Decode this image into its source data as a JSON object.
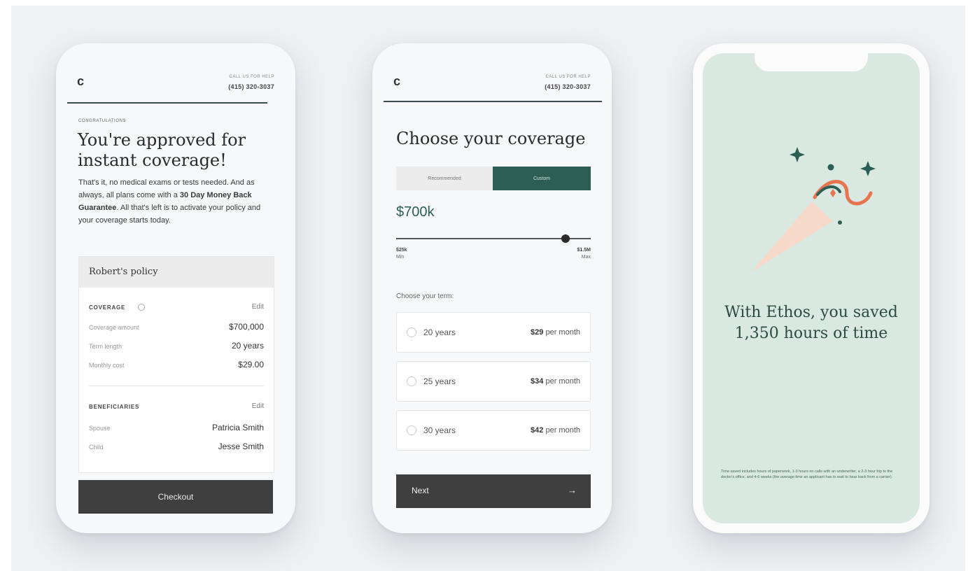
{
  "phone1": {
    "logo": "c",
    "call_label": "CALL US FOR HELP",
    "phone_number": "(415) 320-3037",
    "eyebrow": "CONGRATULATIONS",
    "headline": "You're approved for instant coverage!",
    "body_before": "That's it, no medical exams or tests needed. And as always, all plans come with a ",
    "body_bold": "30 Day Money Back Guarantee",
    "body_after": ". All that's left is to activate your policy and your coverage starts today.",
    "policy": {
      "title": "Robert's policy",
      "coverage_section": "COVERAGE",
      "info_icon": "info-icon",
      "coverage_edit": "Edit",
      "rows": [
        {
          "label": "Coverage amount",
          "value": "$700,000"
        },
        {
          "label": "Term length",
          "value": "20 years"
        },
        {
          "label": "Monthly cost",
          "value": "$29.00"
        }
      ],
      "beneficiaries_section": "BENEFICIARIES",
      "beneficiaries_edit": "Edit",
      "beneficiaries": [
        {
          "label": "Spouse",
          "value": "Patricia Smith"
        },
        {
          "label": "Child",
          "value": "Jesse Smith"
        }
      ]
    },
    "checkout_label": "Checkout"
  },
  "phone2": {
    "logo": "c",
    "call_label": "CALL US FOR HELP",
    "phone_number": "(415) 320-3037",
    "title": "Choose your coverage",
    "toggle_left": "Recommended",
    "toggle_right": "Custom",
    "amount": "$700k",
    "slider": {
      "min_value": "$25k",
      "min_label": "Min",
      "max_value": "$1.5M",
      "max_label": "Max",
      "position_fraction": 0.87
    },
    "term_prompt": "Choose your term:",
    "terms": [
      {
        "years": "20 years",
        "price": "$29",
        "per": "per month"
      },
      {
        "years": "25 years",
        "price": "$34",
        "per": "per month"
      },
      {
        "years": "30 years",
        "price": "$42",
        "per": "per month"
      }
    ],
    "next_label": "Next",
    "next_arrow": "→"
  },
  "phone3": {
    "headline_line1": "With Ethos, you saved",
    "headline_line2": "1,350 hours of time",
    "footnote": "Time saved includes hours of paperwork, 1-3 hours on calls with an underwriter, a 2-3 hour trip to the doctor's office, and 4-6 weeks (the average time an applicant has to wait to hear back from a carrier).",
    "illustration": "party-popper-icon",
    "colors": {
      "background": "#d9e8e0",
      "accent_green": "#2d5e54",
      "accent_orange": "#e8734f",
      "cone": "#f6d9c9"
    }
  },
  "colors": {
    "page_bg": "#eef0f3",
    "button_dark": "#3f3f3f",
    "toggle_active": "#2d5e54"
  }
}
